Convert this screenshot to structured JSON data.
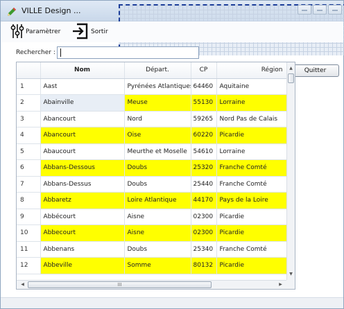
{
  "window": {
    "title": "VILLE Design ...",
    "accent": "#ffff00"
  },
  "toolbar": {
    "params_label": "Paramètrer",
    "quit_label": "Sortir"
  },
  "search": {
    "label": "Rechercher :",
    "value": ""
  },
  "quit_button": "Quitter",
  "table": {
    "columns": [
      "",
      "Nom",
      "Départ.",
      "CP",
      "Région"
    ],
    "rows": [
      {
        "n": "1",
        "nom": "Aast",
        "dep": "Pyrénées Atlantiques",
        "cp": "64460",
        "region": "Aquitaine",
        "hl": false
      },
      {
        "n": "2",
        "nom": "Abainville",
        "dep": "Meuse",
        "cp": "55130",
        "region": "Lorraine",
        "hl": true,
        "sel": true
      },
      {
        "n": "3",
        "nom": "Abancourt",
        "dep": "Nord",
        "cp": "59265",
        "region": "Nord Pas de Calais",
        "hl": false
      },
      {
        "n": "4",
        "nom": "Abancourt",
        "dep": "Oise",
        "cp": "60220",
        "region": "Picardie",
        "hl": true
      },
      {
        "n": "5",
        "nom": "Abaucourt",
        "dep": "Meurthe et Moselle",
        "cp": "54610",
        "region": "Lorraine",
        "hl": false
      },
      {
        "n": "6",
        "nom": "Abbans-Dessous",
        "dep": "Doubs",
        "cp": "25320",
        "region": "Franche Comté",
        "hl": true
      },
      {
        "n": "7",
        "nom": "Abbans-Dessus",
        "dep": "Doubs",
        "cp": "25440",
        "region": "Franche Comté",
        "hl": false
      },
      {
        "n": "8",
        "nom": "Abbaretz",
        "dep": "Loire Atlantique",
        "cp": "44170",
        "region": "Pays de la Loire",
        "hl": true
      },
      {
        "n": "9",
        "nom": "Abbécourt",
        "dep": "Aisne",
        "cp": "02300",
        "region": "Picardie",
        "hl": false
      },
      {
        "n": "10",
        "nom": "Abbecourt",
        "dep": "Aisne",
        "cp": "02300",
        "region": "Picardie",
        "hl": true
      },
      {
        "n": "11",
        "nom": "Abbenans",
        "dep": "Doubs",
        "cp": "25340",
        "region": "Franche Comté",
        "hl": false
      },
      {
        "n": "12",
        "nom": "Abbeville",
        "dep": "Somme",
        "cp": "80132",
        "region": "Picardie",
        "hl": true
      }
    ]
  },
  "hscroll_grip": "III"
}
